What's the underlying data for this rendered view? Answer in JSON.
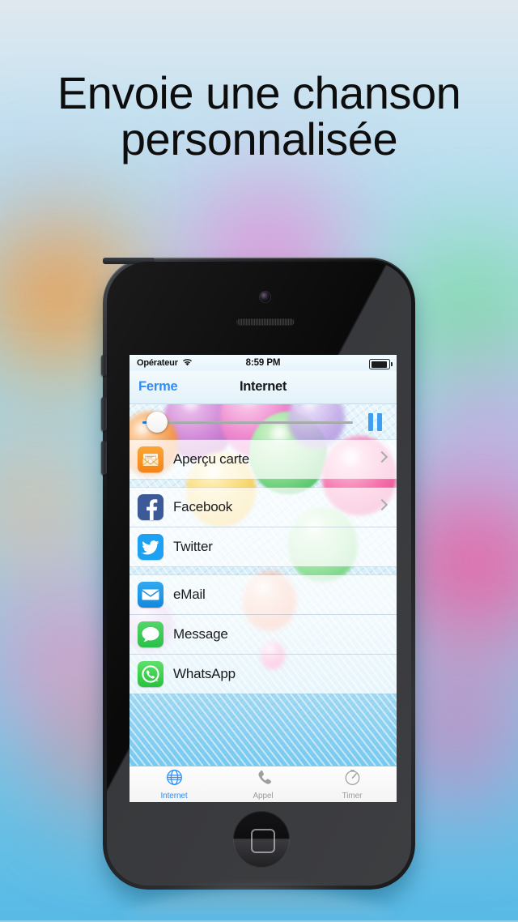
{
  "promo": {
    "headline_line1": "Envoie une chanson",
    "headline_line2": "personnalisée",
    "bg_top_color": "#dfe8ee",
    "bg_bottom_color": "#58bae6"
  },
  "device": {
    "name": "iphone-5-black",
    "home_button": "home-button",
    "camera": "front-camera",
    "speaker": "earpiece-speaker"
  },
  "screen": {
    "statusbar": {
      "carrier": "Opérateur",
      "wifi_icon": "wifi-icon",
      "time": "8:59 PM",
      "battery_icon": "battery-icon"
    },
    "navbar": {
      "back_label": "Ferme",
      "title": "Internet",
      "tint_color": "#2d8ef5"
    },
    "player": {
      "slider_value": 2,
      "slider_min": 0,
      "slider_max": 100,
      "pause_icon": "pause-icon",
      "accent_color": "#3d9ef2"
    },
    "groups": [
      {
        "rows": [
          {
            "label": "Aperçu carte",
            "icon": "envelope-card-icon",
            "chevron": true
          }
        ]
      },
      {
        "rows": [
          {
            "label": "Facebook",
            "icon": "facebook-icon",
            "chevron": true
          },
          {
            "label": "Twitter",
            "icon": "twitter-icon",
            "chevron": false
          }
        ]
      },
      {
        "rows": [
          {
            "label": "eMail",
            "icon": "email-icon",
            "chevron": false
          },
          {
            "label": "Message",
            "icon": "message-icon",
            "chevron": false
          },
          {
            "label": "WhatsApp",
            "icon": "whatsapp-icon",
            "chevron": false
          }
        ]
      }
    ],
    "tabs": [
      {
        "label": "Internet",
        "icon": "globe-icon",
        "active": true
      },
      {
        "label": "Appel",
        "icon": "phone-icon",
        "active": false
      },
      {
        "label": "Timer",
        "icon": "timer-icon",
        "active": false
      }
    ]
  }
}
